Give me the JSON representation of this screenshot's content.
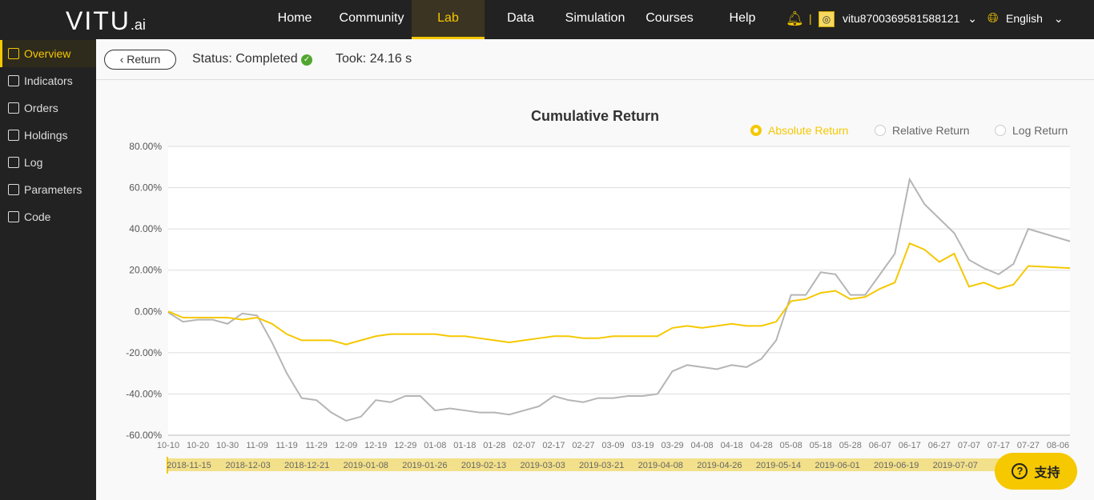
{
  "header": {
    "logo": "VITU",
    "logo_suffix": ".ai",
    "nav": [
      "Home",
      "Community",
      "Lab",
      "Data",
      "Simulation",
      "Courses",
      "Help"
    ],
    "active_nav": "Lab",
    "username": "vitu8700369581588121",
    "language": "English"
  },
  "sidebar": {
    "items": [
      {
        "label": "Overview",
        "icon": "overview-icon"
      },
      {
        "label": "Indicators",
        "icon": "indicators-icon"
      },
      {
        "label": "Orders",
        "icon": "orders-icon"
      },
      {
        "label": "Holdings",
        "icon": "holdings-icon"
      },
      {
        "label": "Log",
        "icon": "log-icon"
      },
      {
        "label": "Parameters",
        "icon": "parameters-icon"
      },
      {
        "label": "Code",
        "icon": "code-icon"
      }
    ]
  },
  "toolbar": {
    "return_label": "Return",
    "status": "Status: Completed",
    "took": "Took: 24.16 s"
  },
  "legend": {
    "options": [
      "Absolute Return",
      "Relative Return",
      "Log Return"
    ],
    "selected": "Absolute Return"
  },
  "support_label": "支持",
  "colors": {
    "accent": "#f5c800",
    "series_gray": "#b5b5b5",
    "series_yellow": "#f5c800"
  },
  "chart_data": {
    "type": "line",
    "title": "Cumulative Return",
    "ylim": [
      -60,
      80
    ],
    "yticks": [
      "80.00%",
      "60.00%",
      "40.00%",
      "20.00%",
      "0.00%",
      "-20.00%",
      "-40.00%",
      "-60.00%"
    ],
    "xticks": [
      "10-10",
      "10-20",
      "10-30",
      "11-09",
      "11-19",
      "11-29",
      "12-09",
      "12-19",
      "12-29",
      "01-08",
      "01-18",
      "01-28",
      "02-07",
      "02-17",
      "02-27",
      "03-09",
      "03-19",
      "03-29",
      "04-08",
      "04-18",
      "04-28",
      "05-08",
      "05-18",
      "05-28",
      "06-07",
      "06-17",
      "06-27",
      "07-07",
      "07-17",
      "07-27",
      "08-06"
    ],
    "grid": true,
    "series": [
      {
        "color": "#b5b5b5",
        "values": [
          -0.5,
          -5,
          -4,
          -4,
          -6,
          -1,
          -2,
          -15,
          -30,
          -42,
          -43,
          -49,
          -53,
          -51,
          -43,
          -44,
          -41,
          -41,
          -48,
          -47,
          -48,
          -49,
          -49,
          -50,
          -48,
          -46,
          -41,
          -43,
          -44,
          -42,
          -42,
          -41,
          -41,
          -40,
          -29,
          -26,
          -27,
          -28,
          -26,
          -27,
          -23,
          -14,
          8,
          8,
          19,
          18,
          8,
          8,
          18,
          28,
          64,
          52,
          45,
          38,
          25,
          21,
          18,
          23,
          40,
          34
        ]
      },
      {
        "color": "#f5c800",
        "values": [
          0,
          -3,
          -3,
          -3,
          -3,
          -4,
          -3,
          -6,
          -11,
          -14,
          -14,
          -14,
          -16,
          -14,
          -12,
          -11,
          -11,
          -11,
          -11,
          -12,
          -12,
          -13,
          -14,
          -15,
          -14,
          -13,
          -12,
          -12,
          -13,
          -13,
          -12,
          -12,
          -12,
          -12,
          -8,
          -7,
          -8,
          -7,
          -6,
          -7,
          -7,
          -5,
          5,
          6,
          9,
          10,
          6,
          7,
          11,
          14,
          33,
          30,
          24,
          28,
          12,
          14,
          11,
          13,
          22,
          21
        ]
      }
    ],
    "range_slider_dates": [
      "2018-11-15",
      "2018-12-03",
      "2018-12-21",
      "2019-01-08",
      "2019-01-26",
      "2019-02-13",
      "2019-03-03",
      "2019-03-21",
      "2019-04-08",
      "2019-04-26",
      "2019-05-14",
      "2019-06-01",
      "2019-06-19",
      "2019-07-07"
    ]
  }
}
